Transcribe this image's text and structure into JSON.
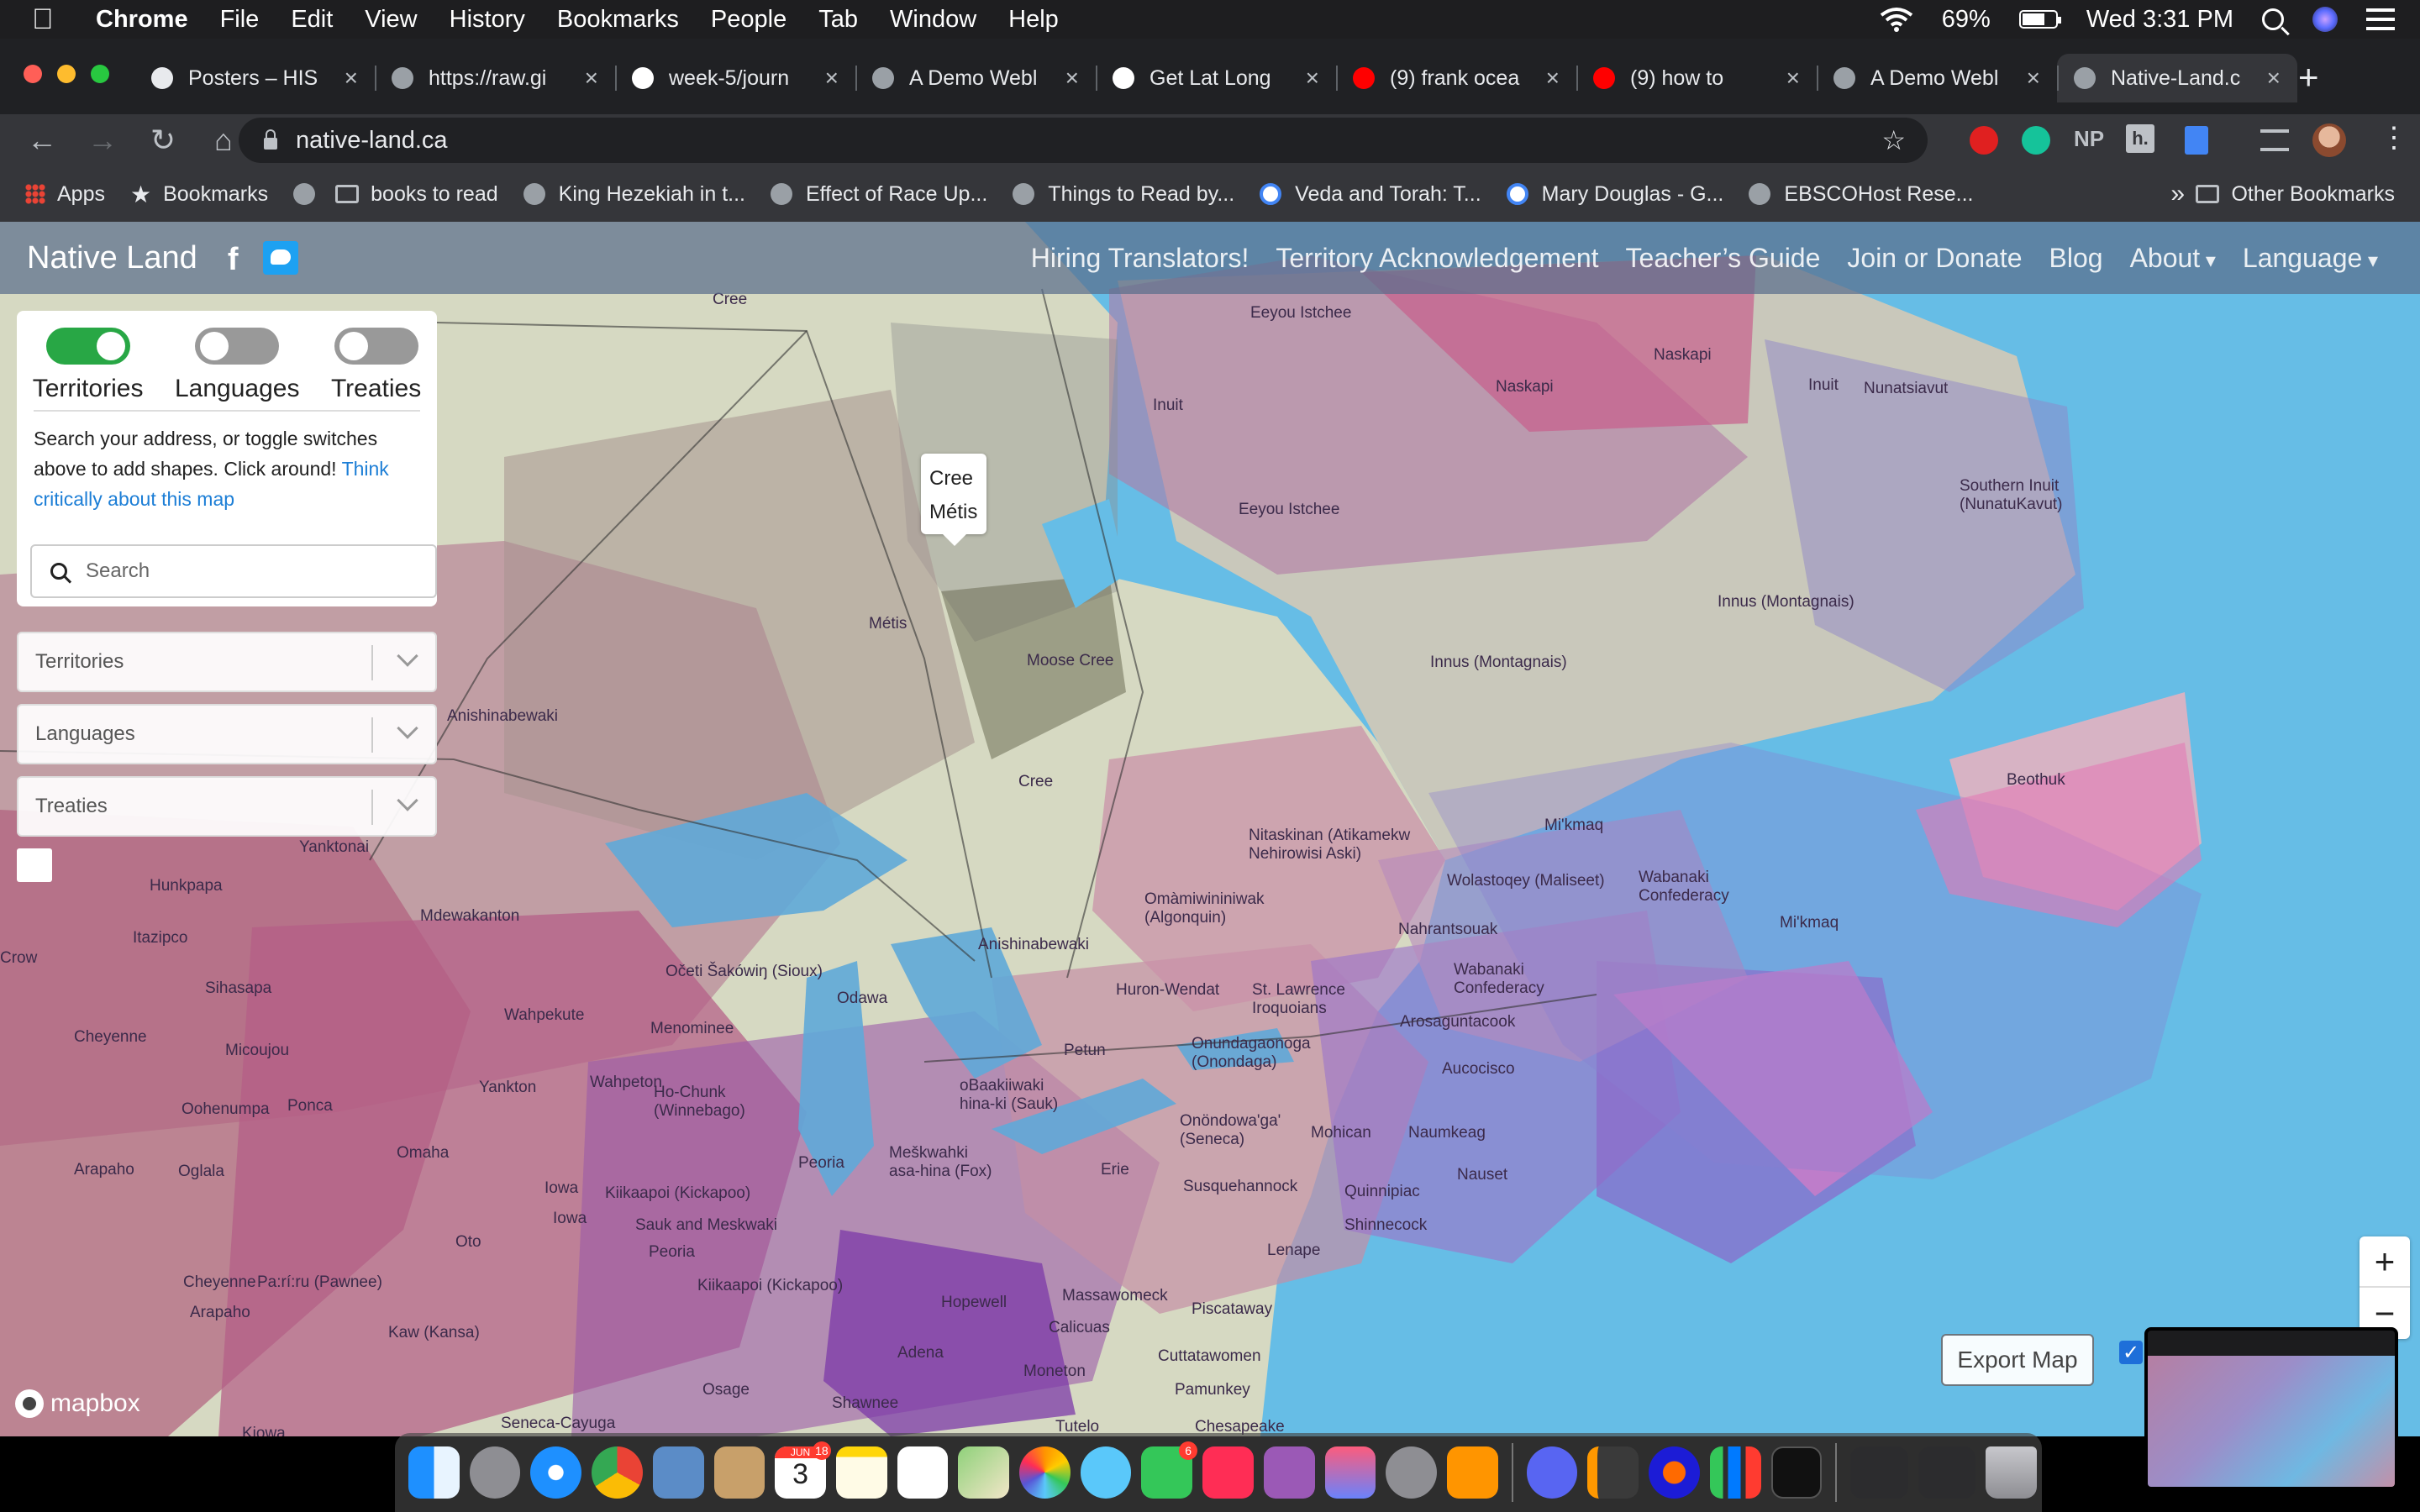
{
  "menubar": {
    "app": "Chrome",
    "items": [
      "File",
      "Edit",
      "View",
      "History",
      "Bookmarks",
      "People",
      "Tab",
      "Window",
      "Help"
    ],
    "battery": "69%",
    "battery_level": 0.69,
    "clock": "Wed 3:31 PM"
  },
  "tabs": [
    {
      "label": "Posters – HIS",
      "color": "#e8eaed"
    },
    {
      "label": "https://raw.gi",
      "color": "#9aa0a6"
    },
    {
      "label": "week-5/journ",
      "color": "#ffffff"
    },
    {
      "label": "A Demo Webl",
      "color": "#9aa0a6"
    },
    {
      "label": "Get Lat Long",
      "color": "#ffffff"
    },
    {
      "label": "(9) frank ocea",
      "color": "#ff0000"
    },
    {
      "label": "(9) how to",
      "color": "#ff0000"
    },
    {
      "label": "A Demo Webl",
      "color": "#9aa0a6"
    },
    {
      "label": "Native-Land.c",
      "color": "#9aa0a6"
    }
  ],
  "omnibox": {
    "url": "native-land.ca"
  },
  "extensions": {
    "np": "NP",
    "h": "h."
  },
  "bookmarks": {
    "items": [
      "Apps",
      "Bookmarks",
      "books to read",
      "King Hezekiah in t...",
      "Effect of Race Up...",
      "Things to Read by...",
      "Veda and Torah: T...",
      "Mary Douglas - G...",
      "EBSCOHost Rese..."
    ],
    "more": "»",
    "other": "Other Bookmarks"
  },
  "site": {
    "brand": "Native Land",
    "nav": [
      "Hiring Translators!",
      "Territory Acknowledgement",
      "Teacher’s Guide",
      "Join or Donate",
      "Blog",
      "About",
      "Language"
    ]
  },
  "panel": {
    "toggles": [
      {
        "label": "Territories",
        "on": true
      },
      {
        "label": "Languages",
        "on": false
      },
      {
        "label": "Treaties",
        "on": false
      }
    ],
    "help_text": "Search your address, or toggle switches above to add shapes. Click around!",
    "help_link": "Think critically about this map",
    "search_placeholder": "Search"
  },
  "dropdowns": [
    "Territories",
    "Languages",
    "Treaties"
  ],
  "popup": {
    "line1": "Cree",
    "line2": "Métis"
  },
  "map_labels": [
    "Cree",
    "Eeyou Istchee",
    "Naskapi",
    "Inuit",
    "Nunatsiavut",
    "Eeyou Istchee",
    "Southern Inuit (NunatuKavut)",
    "Innus (Montagnais)",
    "Innus (Montagnais)",
    "Métis",
    "Moose Cree",
    "Anishinabewaki",
    "Cree",
    "Beothuk",
    "Mi'kmaq",
    "Nitaskinan (Atikamekw Nehirowisi Aski)",
    "Wolastoqey (Maliseet)",
    "Wabanaki Confederacy",
    "Mi'kmaq",
    "Yanktonai",
    "Hunkpapa",
    "Itazipco",
    "Crow",
    "Mdewakanton",
    "Anishinabewaki",
    "Omàmiwininiwak (Algonquin)",
    "Nahrantsouak",
    "Wabanaki Confederacy",
    "Sihasapa",
    "Očeti Šakówiŋ (Sioux)",
    "Odawa",
    "Huron-Wendat",
    "St. Lawrence Iroquoians",
    "Cheyenne",
    "Micoujou",
    "Wahpekute",
    "Menominee",
    "Arosaguntacook",
    "Aucocisco",
    "Oohenumpa",
    "Ponca",
    "Yankton",
    "Wahpeton",
    "Ho-Chunk (Winnebago)",
    "Petun",
    "Onundagaonoga (Onondaga)",
    "Omaha",
    "oBaakiiwaki hina-ki (Sauk)",
    "Onöndowa'ga' (Seneca)",
    "Mohican",
    "Naumkeag",
    "Arapaho",
    "Oglala",
    "Peoria",
    "Meškwahki asa-hina (Fox)",
    "Erie",
    "Susquehannock",
    "Quinnipiac",
    "Nauset",
    "Iowa",
    "Kiikaapoi (Kickapoo)",
    "Iowa",
    "Sauk and Meskwaki",
    "Shinnecock",
    "Oto",
    "Peoria",
    "Lenape",
    "Cheyenne",
    "Pa:rí:ru (Pawnee)",
    "Kiikaapoi (Kickapoo)",
    "Arapaho",
    "Massawomeck",
    "Piscataway",
    "Hopewell",
    "Calicuas",
    "Kaw (Kansa)",
    "Adena",
    "Cuttatawomen",
    "Moneton",
    "Pamunkey",
    "Osage",
    "Shawnee",
    "Tutelo",
    "Chesapeake",
    "Seneca-Cayuga",
    "Kiowa"
  ],
  "map_controls": {
    "zoom_in": "+",
    "zoom_out": "−",
    "export": "Export Map",
    "check": "✓",
    "attribution": "mapbox"
  },
  "dock": {
    "calendar_month": "JUN",
    "calendar_day": "3",
    "calendar_badge": "18",
    "facetime_badge": "6"
  },
  "colors": {
    "water": "#66bde6",
    "land": "#d9dcc6",
    "header": "#5a6e8c",
    "toggle_on": "#28a745",
    "link": "#1c7ed6"
  }
}
